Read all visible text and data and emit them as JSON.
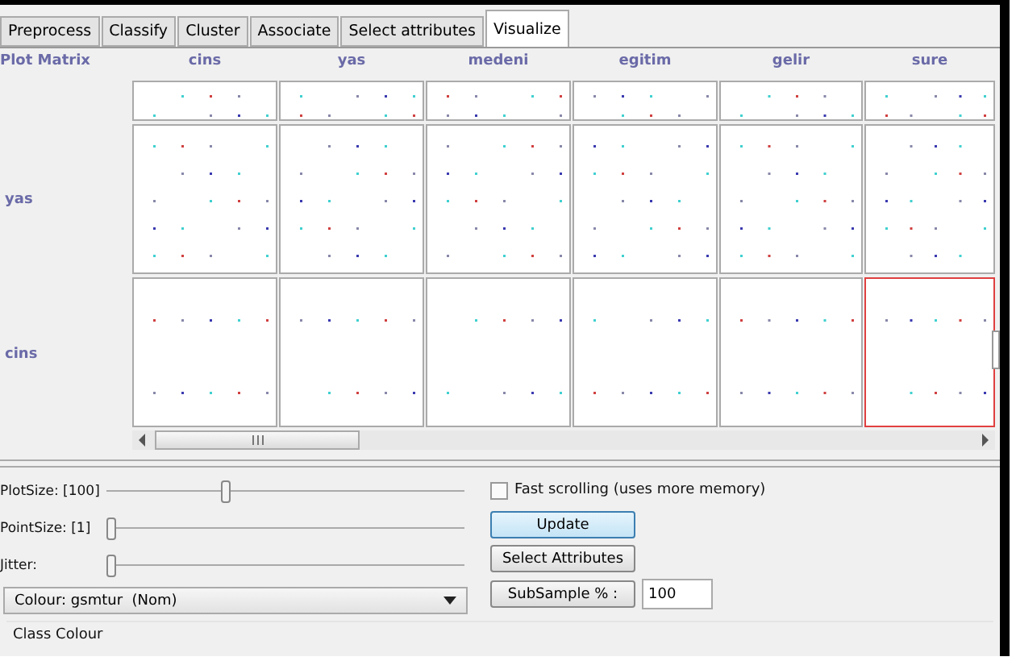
{
  "tabs": [
    {
      "label": "Preprocess",
      "selected": false
    },
    {
      "label": "Classify",
      "selected": false
    },
    {
      "label": "Cluster",
      "selected": false
    },
    {
      "label": "Associate",
      "selected": false
    },
    {
      "label": "Select attributes",
      "selected": false
    },
    {
      "label": "Visualize",
      "selected": true
    }
  ],
  "matrix": {
    "title": "Plot Matrix",
    "columns": [
      "cins",
      "yas",
      "medeni",
      "egitim",
      "gelir",
      "sure"
    ],
    "clipped_top_row": true,
    "rows": [
      {
        "label": "yas",
        "cells": [
          {
            "selected": false
          },
          {
            "selected": false
          },
          {
            "selected": false
          },
          {
            "selected": false
          },
          {
            "selected": false
          },
          {
            "selected": false
          }
        ]
      },
      {
        "label": "cins",
        "cells": [
          {
            "selected": false
          },
          {
            "selected": false
          },
          {
            "selected": false
          },
          {
            "selected": false
          },
          {
            "selected": false
          },
          {
            "selected": true
          }
        ]
      }
    ]
  },
  "controls": {
    "sliders": [
      {
        "label": "PlotSize: [100]",
        "level": 0.32
      },
      {
        "label": "PointSize: [1]",
        "level": 0
      },
      {
        "label": "Jitter:",
        "level": 0
      }
    ],
    "colour": "Colour: gsmtur  (Nom)",
    "fast_scrolling": {
      "label": "Fast scrolling (uses more memory)",
      "checked": false
    },
    "update_button": {
      "label": "Update",
      "focused": true
    },
    "select_attributes_button": "Select Attributes",
    "subsample_button": "SubSample % :",
    "subsample_value": "100",
    "class_colour": "Class Colour"
  }
}
